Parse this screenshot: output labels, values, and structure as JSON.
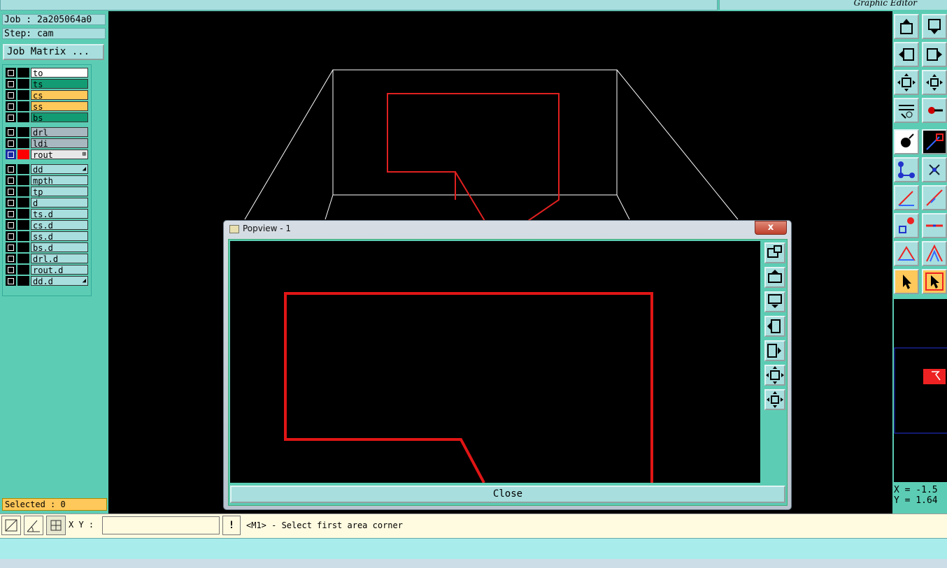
{
  "app": {
    "title": "Graphic Editor"
  },
  "job": {
    "job_line": "Job : 2a205064a0",
    "step_line": "Step: cam",
    "matrix_button": "Job Matrix ..."
  },
  "layers": [
    {
      "name": "to",
      "color": "#ffffff",
      "mark": ""
    },
    {
      "name": "ts",
      "color": "#139c73",
      "mark": ""
    },
    {
      "name": "cs",
      "color": "#ffc85a",
      "mark": ""
    },
    {
      "name": "ss",
      "color": "#ffc85a",
      "mark": ""
    },
    {
      "name": "bs",
      "color": "#139c73",
      "mark": ""
    },
    {
      "name": "drl",
      "color": "#a8b8c0",
      "mark": ""
    },
    {
      "name": "ldi",
      "color": "#a8b8c0",
      "mark": ""
    },
    {
      "name": "rout",
      "color": "#e8e8e8",
      "mark": "⊞",
      "active": true
    },
    {
      "name": "dd",
      "color": "#a8dede",
      "mark": "◢"
    },
    {
      "name": "mpth",
      "color": "#a8dede",
      "mark": ""
    },
    {
      "name": "tp",
      "color": "#a8dede",
      "mark": ""
    },
    {
      "name": "d",
      "color": "#a8dede",
      "mark": ""
    },
    {
      "name": "ts.d",
      "color": "#a8dede",
      "mark": ""
    },
    {
      "name": "cs.d",
      "color": "#a8dede",
      "mark": ""
    },
    {
      "name": "ss.d",
      "color": "#a8dede",
      "mark": ""
    },
    {
      "name": "bs.d",
      "color": "#a8dede",
      "mark": ""
    },
    {
      "name": "drl.d",
      "color": "#a8dede",
      "mark": ""
    },
    {
      "name": "rout.d",
      "color": "#a8dede",
      "mark": ""
    },
    {
      "name": "dd.d",
      "color": "#a8dede",
      "mark": "◢"
    }
  ],
  "selected": {
    "label": "Selected : 0"
  },
  "coords": {
    "x": "X = -1.5",
    "y": "Y = 1.64"
  },
  "input": {
    "label": "X Y :",
    "value": ""
  },
  "prompt": {
    "bang": "!",
    "text": "<M1> - Select first area corner"
  },
  "popview": {
    "title": "Popview - 1",
    "close_x": "x",
    "close_button": "Close"
  },
  "colors": {
    "panel": "#5ccdb4",
    "button": "#a8dede",
    "highlight": "#ffc85a",
    "rout": "#ff0000"
  }
}
